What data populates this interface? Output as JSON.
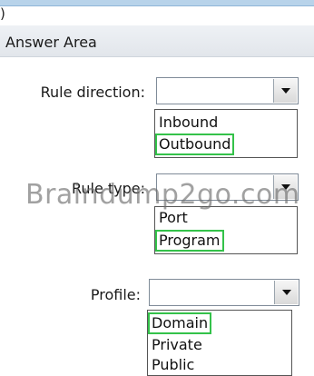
{
  "fragment": ")",
  "header": {
    "title": "Answer Area"
  },
  "rule_direction": {
    "label": "Rule direction:",
    "selected_value": "",
    "options": [
      "Inbound",
      "Outbound"
    ],
    "highlighted": "Outbound"
  },
  "rule_type": {
    "label": "Rule type:",
    "selected_value": "",
    "options": [
      "Port",
      "Program"
    ],
    "highlighted": "Program"
  },
  "profile": {
    "label": "Profile:",
    "selected_value": "",
    "options": [
      "Domain",
      "Private",
      "Public"
    ],
    "highlighted": "Domain"
  },
  "watermark": "Braindump2go.com",
  "colors": {
    "highlight": "#34c24a",
    "header_bg": "#e6e9ee"
  }
}
